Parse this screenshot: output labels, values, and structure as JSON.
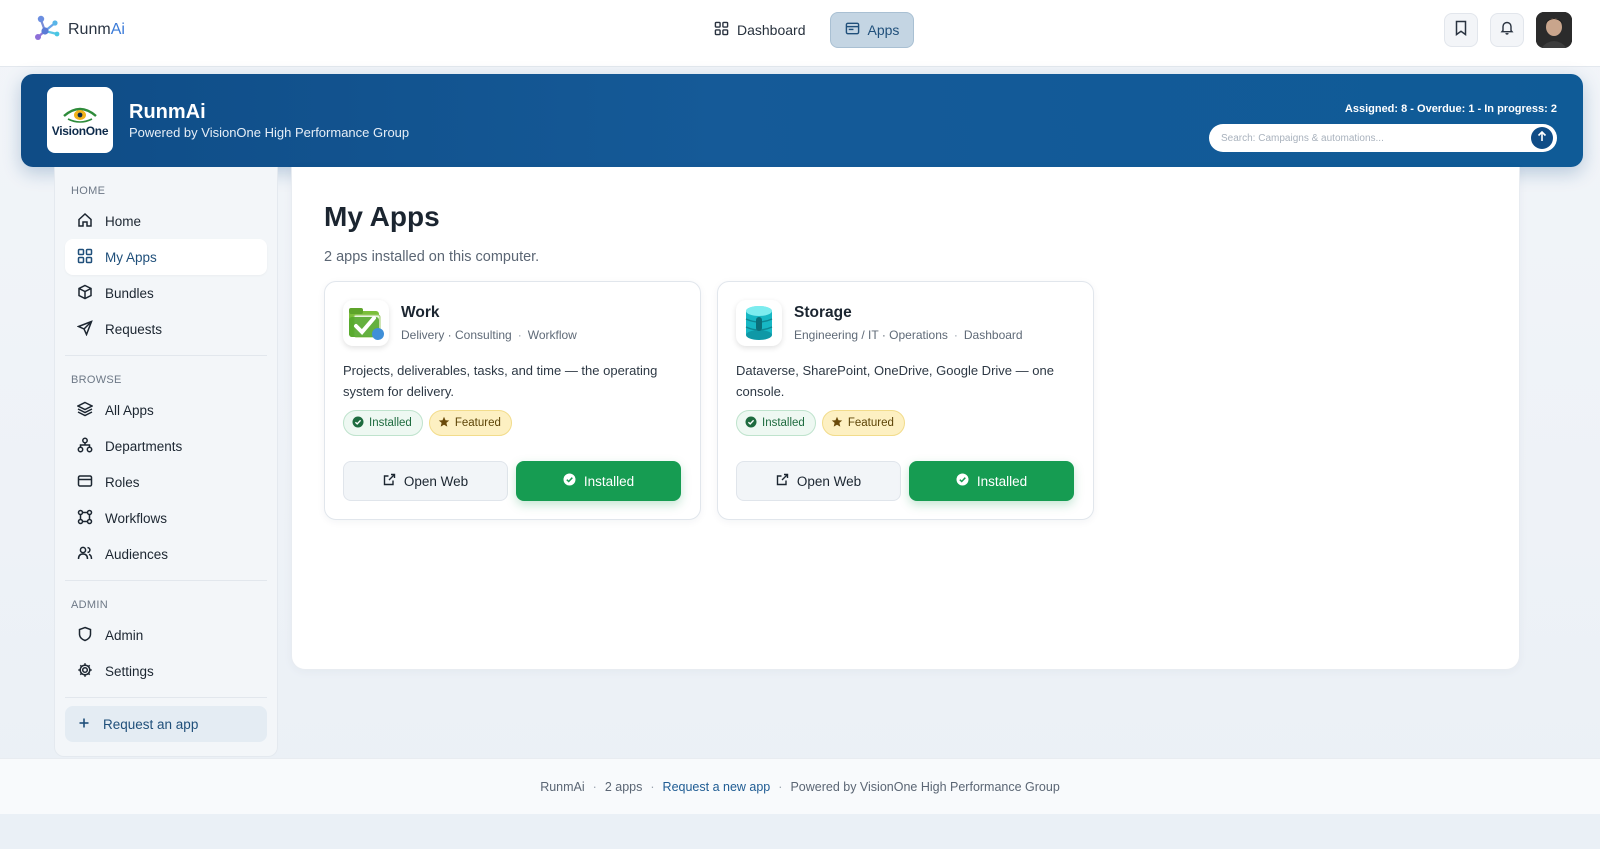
{
  "brand": {
    "name_main": "Runm",
    "name_accent": "Ai"
  },
  "topnav": {
    "dashboard_label": "Dashboard",
    "apps_label": "Apps"
  },
  "hero": {
    "logo_text": "VisionOne",
    "title": "RunmAi",
    "subtitle": "Powered by VisionOne High Performance Group",
    "stats": "Assigned: 8 - Overdue: 1 - In progress: 2",
    "search_placeholder": "Search: Campaigns & automations..."
  },
  "sidebar": {
    "home_heading": "HOME",
    "home_items": [
      {
        "label": "Home",
        "icon": "home-icon"
      },
      {
        "label": "My Apps",
        "icon": "grid-icon"
      },
      {
        "label": "Bundles",
        "icon": "cube-icon"
      },
      {
        "label": "Requests",
        "icon": "send-icon"
      }
    ],
    "browse_heading": "BROWSE",
    "browse_items": [
      {
        "label": "All Apps",
        "icon": "layers-icon"
      },
      {
        "label": "Departments",
        "icon": "org-chart-icon"
      },
      {
        "label": "Roles",
        "icon": "id-card-icon"
      },
      {
        "label": "Workflows",
        "icon": "workflow-icon"
      },
      {
        "label": "Audiences",
        "icon": "users-icon"
      }
    ],
    "admin_heading": "ADMIN",
    "admin_items": [
      {
        "label": "Admin",
        "icon": "shield-icon"
      },
      {
        "label": "Settings",
        "icon": "gear-icon"
      }
    ],
    "cta_label": "Request an app"
  },
  "main": {
    "title": "My Apps",
    "subtitle": "2 apps installed on this computer.",
    "cards": [
      {
        "title": "Work",
        "tag1": "Delivery · Consulting",
        "tag2": "Workflow",
        "description": "Projects, deliverables, tasks, and time — the operating system for delivery.",
        "badge_installed": "Installed",
        "badge_featured": "Featured",
        "open_label": "Open Web",
        "primary_label": "Installed"
      },
      {
        "title": "Storage",
        "tag1": "Engineering / IT · Operations",
        "tag2": "Dashboard",
        "description": "Dataverse, SharePoint, OneDrive, Google Drive — one console.",
        "badge_installed": "Installed",
        "badge_featured": "Featured",
        "open_label": "Open Web",
        "primary_label": "Installed"
      }
    ]
  },
  "footer": {
    "brand": "RunmAi",
    "count": "2 apps",
    "link": "Request a new app",
    "powered": "Powered by VisionOne High Performance Group"
  },
  "colors": {
    "accent": "#0f4c86",
    "success": "#169c52",
    "featured": "#fdf0c2"
  }
}
